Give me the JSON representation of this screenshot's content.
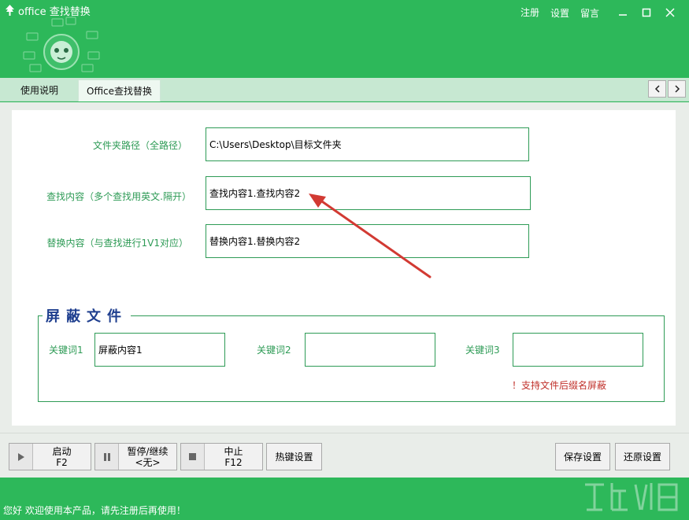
{
  "window": {
    "title": "office 查找替换",
    "links": [
      "注册",
      "设置",
      "留言"
    ],
    "controls": {
      "minimize": "—",
      "maximize": "☐",
      "close": "✕"
    }
  },
  "tabs": [
    {
      "label": "使用说明",
      "active": false
    },
    {
      "label": "Office查找替换",
      "active": true
    }
  ],
  "nav": {
    "prev": "<",
    "next": ">"
  },
  "form": {
    "folder_label": "文件夹路径（全路径）",
    "folder_value": "C:\\Users\\Desktop\\目标文件夹",
    "find_label": "查找内容（多个查找用英文.隔开）",
    "find_value": "查找内容1.查找内容2",
    "replace_label": "替换内容（与查找进行1V1对应）",
    "replace_value": "替换内容1.替换内容2"
  },
  "mask": {
    "title": "屏蔽文件",
    "kw1_label": "关键词1",
    "kw1_value": "屏蔽内容1",
    "kw2_label": "关键词2",
    "kw2_value": "",
    "kw3_label": "关键词3",
    "kw3_value": "",
    "note": "！支持文件后缀名屏蔽"
  },
  "toolbar": {
    "start_label": "启动",
    "start_key": "F2",
    "pause_label": "暂停/继续",
    "pause_key": "<无>",
    "stop_label": "中止",
    "stop_key": "F12",
    "hotkey_label": "热键设置",
    "save_label": "保存设置",
    "restore_label": "还原设置"
  },
  "status": {
    "message": "您好 欢迎使用本产品，请先注册后再使用！"
  },
  "colors": {
    "brand_green": "#2db85a",
    "label_green": "#2e9b56",
    "arrow_red": "#d23a33",
    "group_title_blue": "#1f3f8f"
  }
}
